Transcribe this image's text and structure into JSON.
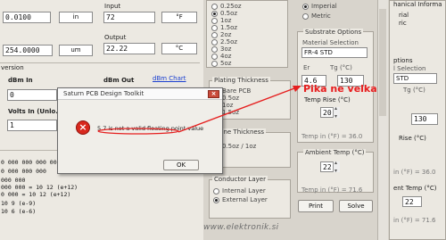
{
  "window": {
    "title": "Saturn PCB Design Toolkit"
  },
  "left_top": {
    "field1_value": "0.0100",
    "field1_unit": "in",
    "field2_value": "254.0000",
    "field2_unit": "um",
    "input_label": "Input",
    "input_value": "72",
    "input_unit": "°F",
    "output_label": "Output",
    "output_value": "22.22",
    "output_unit": "°C"
  },
  "conversion": {
    "section_label": "version",
    "dbm_in_label": "dBm In",
    "dbm_in_value": "0",
    "dbm_out_label": "dBm Out",
    "volts_in_label": "Volts In (Unlo...",
    "volts_in_value": "1",
    "dbm_chart_link": "dBm Chart"
  },
  "console_lines": [
    "0 000 000 000 000",
    "0 000 000 000",
    "000 000",
    "000 000 = 10 12 (e+12)",
    "0 000 = 10 12 (e+12)",
    "10 9 (e-9)",
    "10 6 (e-6)"
  ],
  "copper": {
    "options": [
      "0.25oz",
      "0.5oz",
      "1oz",
      "1.5oz",
      "2oz",
      "2.5oz",
      "3oz",
      "4oz",
      "5oz"
    ],
    "selected_index": 1
  },
  "plating": {
    "title": "Plating Thickness",
    "options": [
      "Bare PCB",
      "0.5oz",
      "1oz",
      "1.5oz",
      "2oz"
    ],
    "selected_index": 0
  },
  "plane": {
    "title": "Plane Thickness",
    "value": "0.5oz / 1oz"
  },
  "conductor": {
    "title": "Conductor Layer",
    "option1": "Internal Layer",
    "option2": "External Layer"
  },
  "units": {
    "imperial": "Imperial",
    "metric": "Metric"
  },
  "substrate": {
    "title": "Substrate Options",
    "material_label": "Material Selection",
    "material_value": "FR-4 STD",
    "er_label": "Er",
    "tg_label": "Tg (°C)",
    "er_value": "4.6",
    "tg_value": "130",
    "temp_rise_label": "Temp Rise (°C)",
    "temp_rise_value": "20",
    "temp_readout": "Temp in (°F) = 36.0"
  },
  "ambient": {
    "title": "Ambient Temp (°C)",
    "value": "22",
    "readout": "Temp in (°F) = 71.6"
  },
  "buttons": {
    "print": "Print",
    "solve": "Solve"
  },
  "right_clip": {
    "tab": "hanical Informa",
    "line1": "rial",
    "line2": "ric",
    "label1": "ptions",
    "label2": "l Selection",
    "select": "STD",
    "tg": "Tg (°C)",
    "tg_value": "130",
    "rise_label": "Rise (°C)",
    "rise_readout": "in (°F) = 36.0",
    "ambient_label": "ent Temp (°C)",
    "ambient_value": "22",
    "ambient_readout": "in (°F) = 71.6"
  },
  "dialog": {
    "title": "Saturn PCB Design Toolkit",
    "message": "5.7 is not a valid floating point value",
    "ok": "OK"
  },
  "annotation": {
    "text": "Pika ne velka",
    "color": "#e51f1f"
  },
  "watermark": "www.elektronik.si"
}
